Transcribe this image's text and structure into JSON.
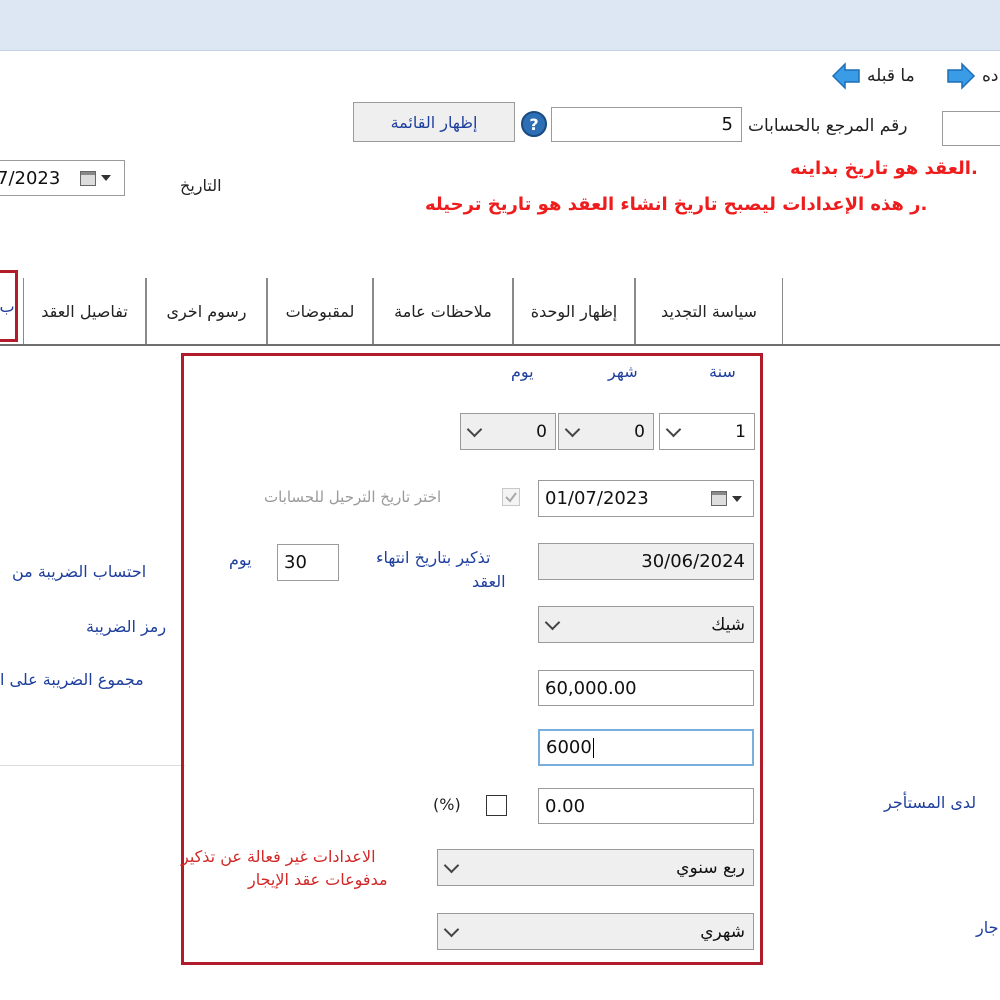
{
  "nav": {
    "next_label": "ده",
    "prev_label": "ما قبله"
  },
  "ref": {
    "label": "رقم المرجع بالحسابات",
    "value": "5",
    "show_list_label": "إظهار القائمة"
  },
  "date": {
    "label": "التاريخ",
    "value": "7/2023"
  },
  "notes": {
    "line1": "العقد هو تاريخ بداينه.",
    "line2": "ر هذه الإعدادات ليصبح تاريخ انشاء العقد هو تاريخ ترحيله."
  },
  "tabs": [
    "سياسة التجديد",
    "إظهار الوحدة",
    "ملاحظات عامة",
    "لمقبوضات",
    "رسوم اخرى",
    "تفاصيل العقد",
    "ب"
  ],
  "duration": {
    "year_label": "سنة",
    "month_label": "شهر",
    "day_label": "يوم",
    "year_value": "1",
    "month_value": "0",
    "day_value": "0"
  },
  "start_date": {
    "value": "01/07/2023",
    "post_checkbox_label": "اختر تاريخ الترحيل للحسابات"
  },
  "reminder": {
    "label_line1": "تذكير بتاريخ انتهاء",
    "label_line2": "العقد",
    "days": "30",
    "days_unit": "يوم",
    "end_date": "30/06/2024"
  },
  "payment_type": {
    "value": "شيك"
  },
  "amounts": {
    "total": "60,000.00",
    "current_input": "6000",
    "percent_value": "0.00",
    "percent_label": "(%)"
  },
  "frequency": {
    "value1": "ربع سنوي",
    "value2": "شهري"
  },
  "warning": {
    "line1": "الاعدادات غير فعالة عن تذكير",
    "line2": "مدفوعات عقد الإيجار"
  },
  "tax": {
    "calc_label": "احتساب الضريبة من",
    "code_label": "رمز الضريبة",
    "total_label": "مجموع الضريبة على ا"
  },
  "right_labels": {
    "tenant_label": "لدى المستأجر",
    "rent_label": "جار"
  },
  "colors": {
    "highlight_border": "#b01c2a",
    "link_blue": "#1f3f9e",
    "warning_red": "#ee1c1c"
  }
}
